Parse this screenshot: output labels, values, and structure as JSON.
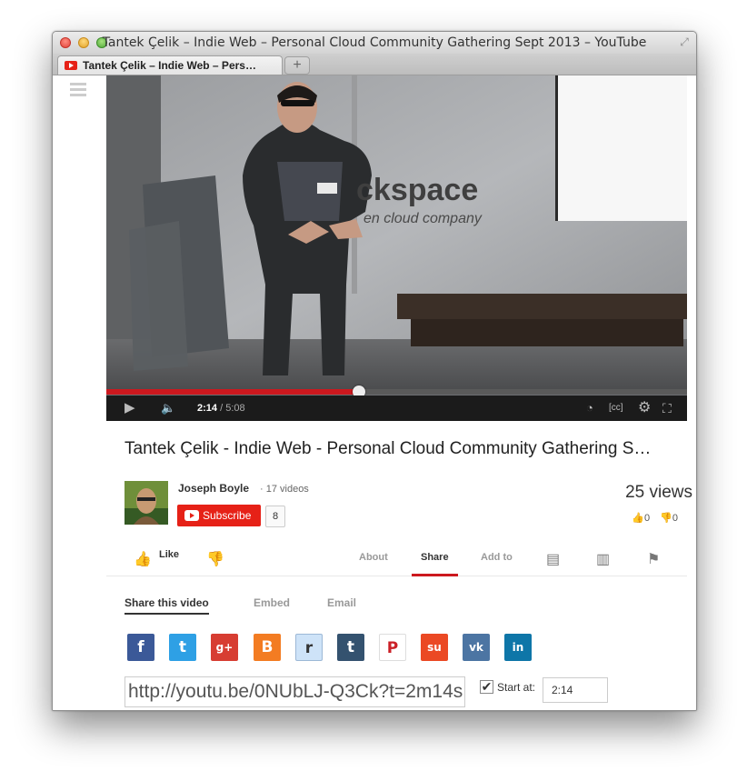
{
  "window": {
    "title": "Tantek Çelik – Indie Web – Personal Cloud Community Gathering Sept 2013 – YouTube",
    "tab_label": "Tantek Çelik – Indie Web – Pers…",
    "new_tab_symbol": "+"
  },
  "video": {
    "current_time": "2:14",
    "duration": "/ 5:08",
    "progress_fraction": 0.435,
    "backdrop_text_1": "ckspace",
    "backdrop_text_2": "en cloud company"
  },
  "info": {
    "title": "Tantek Çelik - Indie Web - Personal Cloud Community Gathering S…",
    "channel_name": "Joseph Boyle",
    "video_count": "· 17 videos",
    "subscribe_label": "Subscribe",
    "subscriber_count": "8",
    "views": "25 views",
    "likes": "0",
    "dislikes": "0"
  },
  "actions": {
    "like_label": "Like",
    "tabs": [
      "About",
      "Share",
      "Add to"
    ],
    "selected_tab": "Share"
  },
  "share": {
    "tabs": [
      "Share this video",
      "Embed",
      "Email"
    ],
    "selected": "Share this video",
    "services": [
      {
        "name": "facebook",
        "glyph": "f",
        "color": "#3b5998"
      },
      {
        "name": "twitter",
        "glyph": "t",
        "color": "#2ea0e5"
      },
      {
        "name": "google-plus",
        "glyph": "g+",
        "color": "#d73d32"
      },
      {
        "name": "blogger",
        "glyph": "B",
        "color": "#f37c22"
      },
      {
        "name": "reddit",
        "glyph": "r",
        "color": "#cee3f8"
      },
      {
        "name": "tumblr",
        "glyph": "t",
        "color": "#34526f"
      },
      {
        "name": "pinterest",
        "glyph": "P",
        "color": "#cb2027"
      },
      {
        "name": "stumbleupon",
        "glyph": "su",
        "color": "#eb4924"
      },
      {
        "name": "vk",
        "glyph": "vk",
        "color": "#4c75a3"
      },
      {
        "name": "linkedin",
        "glyph": "in",
        "color": "#0e76a8"
      }
    ],
    "url": "http://youtu.be/0NUbLJ-Q3Ck?t=2m14s",
    "start_at_label": "Start at:",
    "start_at_checked": true,
    "start_at_value": "2:14"
  }
}
